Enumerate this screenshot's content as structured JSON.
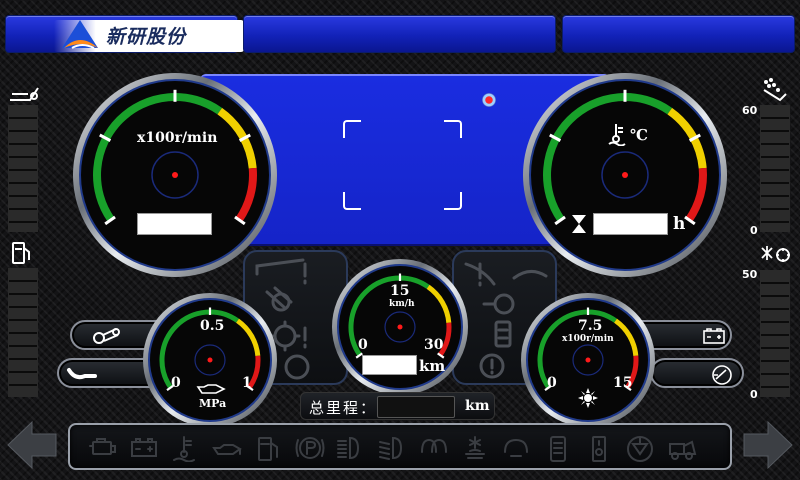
{
  "header": {
    "logo_text": "新研股份",
    "logo_icon": "triangle-logo-icon"
  },
  "screen": {
    "focus_icon": "focus-frame-icon",
    "status_icon": "record-dot-icon"
  },
  "gauges": {
    "tachometer": {
      "unit": "x100r/min"
    },
    "coolant": {
      "unit": "℃",
      "hours_unit": "h"
    },
    "pressure": {
      "mid": "0.5",
      "min": "0",
      "max": "1",
      "unit": "MPa"
    },
    "speedometer": {
      "mid": "15",
      "unit": "km/h",
      "min": "0",
      "max": "30",
      "distance_unit": "km"
    },
    "engine_speed": {
      "mid": "7.5",
      "unit": "x100r/min",
      "min": "0",
      "max": "15"
    }
  },
  "side_scales": {
    "right_top": {
      "max": "60",
      "min": "0"
    },
    "right_bottom": {
      "max": "50",
      "min": "0"
    }
  },
  "odometer": {
    "label": "总里程：",
    "value": "",
    "unit": "km"
  },
  "indicators": [
    "engine-icon",
    "battery-icon",
    "coolant-temp-icon",
    "oil-pressure-icon",
    "fuel-icon",
    "parking-brake-icon",
    "high-beam-icon",
    "low-beam-icon",
    "glow-plug-icon",
    "cabin-fan-icon",
    "seat-icon",
    "hydraulic-filter-icon",
    "fuel-filter-icon",
    "cutter-icon",
    "harvester-icon"
  ],
  "colors": {
    "accent_blue": "#1524c8",
    "green": "#18a02a",
    "yellow": "#f0d000",
    "red": "#e01818"
  }
}
